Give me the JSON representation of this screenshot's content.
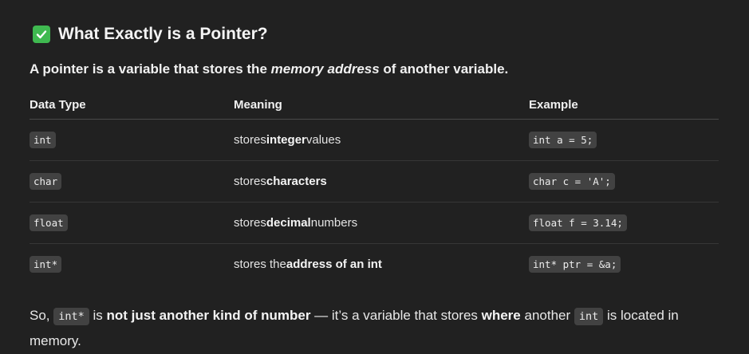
{
  "heading": {
    "icon": "check-mark-button-icon",
    "title": "What Exactly is a Pointer?"
  },
  "intro": {
    "before": "A pointer is a variable that stores the ",
    "emphasis": "memory address",
    "after": " of another variable."
  },
  "table": {
    "headers": [
      "Data Type",
      "Meaning",
      "Example"
    ],
    "rows": [
      {
        "type": "int",
        "meaning_before": "stores ",
        "meaning_bold": "integer",
        "meaning_after": " values",
        "example": "int a = 5;"
      },
      {
        "type": "char",
        "meaning_before": "stores ",
        "meaning_bold": "characters",
        "meaning_after": "",
        "example": "char c = 'A';"
      },
      {
        "type": "float",
        "meaning_before": "stores ",
        "meaning_bold": "decimal",
        "meaning_after": " numbers",
        "example": "float f = 3.14;"
      },
      {
        "type": "int*",
        "meaning_before": "stores the ",
        "meaning_bold": "address of an int",
        "meaning_after": "",
        "example": "int* ptr = &a;"
      }
    ]
  },
  "summary": {
    "t1": "So, ",
    "code1": "int*",
    "t2": " is ",
    "b1": "not just another kind of number",
    "t3": " — it’s a variable that stores ",
    "b2": "where",
    "t4": " another ",
    "code2": "int",
    "t5": " is located in memory."
  },
  "colors": {
    "background": "#212121",
    "check_icon": "#3fb950",
    "code_background": "#424242"
  }
}
